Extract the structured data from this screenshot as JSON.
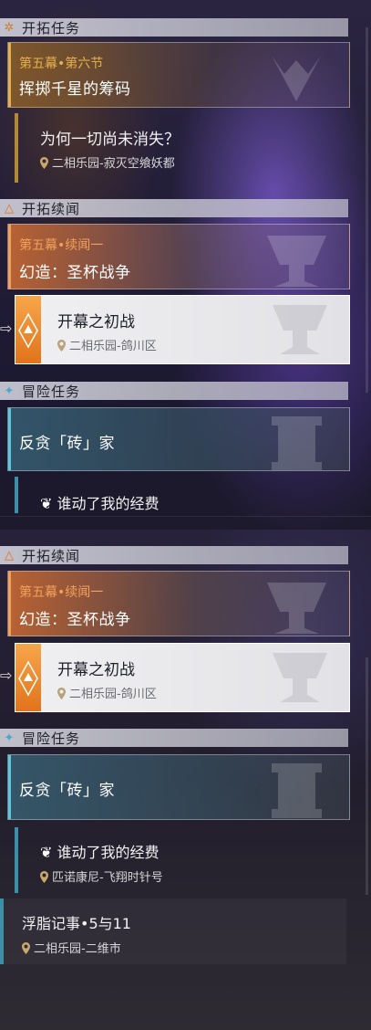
{
  "top": {
    "section1": {
      "title": "开拓任务"
    },
    "main_card": {
      "chapter": "第五幕•第六节",
      "title": "挥掷千星的筹码"
    },
    "main_quest": {
      "title": "为何一切尚未消失？",
      "location": "二相乐园-寂灭空飨妖都"
    },
    "section2": {
      "title": "开拓续闻"
    },
    "side_card": {
      "chapter": "第五幕•续闻一",
      "title": "幻造：圣杯战争"
    },
    "selected_quest": {
      "title": "开幕之初战",
      "location": "二相乐园-鸽川区"
    },
    "section3": {
      "title": "冒险任务"
    },
    "adv_card": {
      "title": "反贪「砖」家"
    },
    "partial_quest": {
      "title": "谁动了我的经费"
    }
  },
  "bottom": {
    "section2": {
      "title": "开拓续闻"
    },
    "side_card": {
      "chapter": "第五幕•续闻一",
      "title": "幻造：圣杯战争"
    },
    "selected_quest": {
      "title": "开幕之初战",
      "location": "二相乐园-鸽川区"
    },
    "section3": {
      "title": "冒险任务"
    },
    "adv_card": {
      "title": "反贪「砖」家"
    },
    "quest1": {
      "title": "谁动了我的经费",
      "location": "匹诺康尼-飞翔时针号"
    },
    "quest2": {
      "title": "浮脂记事•5与11",
      "location": "二相乐园-二维市"
    }
  },
  "colors": {
    "gold": "#e6b14a",
    "orange": "#f3a15a",
    "teal": "#5ac8e0",
    "accent_orange": "#e6771e"
  }
}
